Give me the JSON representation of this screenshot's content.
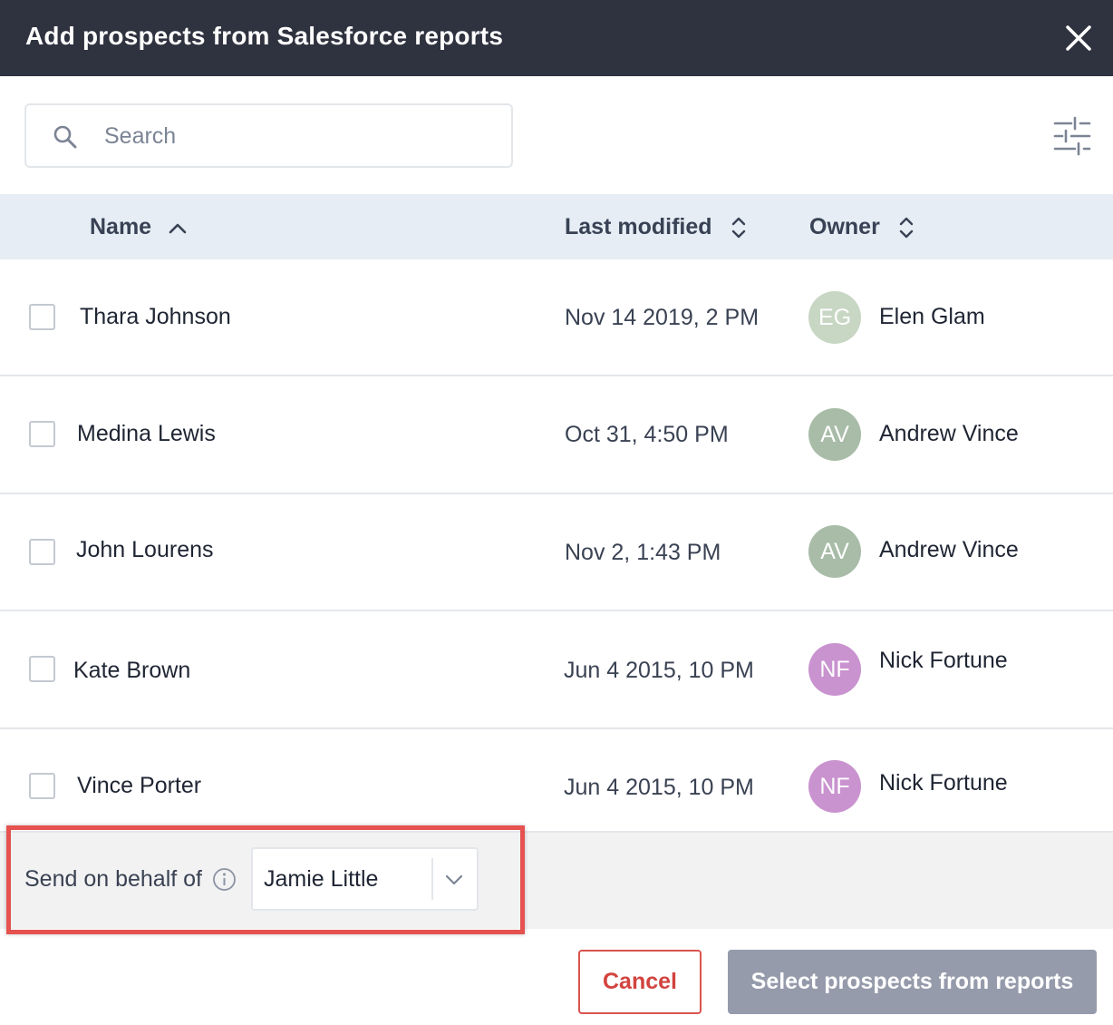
{
  "header": {
    "title": "Add prospects from Salesforce reports"
  },
  "search": {
    "placeholder": "Search",
    "value": ""
  },
  "table": {
    "columns": {
      "name": "Name",
      "last_modified": "Last modified",
      "owner": "Owner"
    },
    "rows": [
      {
        "name": "Thara Johnson",
        "last_modified": "Nov 14 2019, 2 PM",
        "owner_initials": "EG",
        "owner": "Elen Glam",
        "owner_color": "#c8d6c4",
        "checked": false
      },
      {
        "name": "Medina Lewis",
        "last_modified": "Oct 31, 4:50 PM",
        "owner_initials": "AV",
        "owner": "Andrew Vince",
        "owner_color": "#a8bca8",
        "checked": false
      },
      {
        "name": "John Lourens",
        "last_modified": "Nov 2, 1:43 PM",
        "owner_initials": "AV",
        "owner": "Andrew Vince",
        "owner_color": "#a8bca8",
        "checked": false
      },
      {
        "name": "Kate Brown",
        "last_modified": "Jun 4 2015, 10 PM",
        "owner_initials": "NF",
        "owner": "Nick Fortune",
        "owner_color": "#c993cf",
        "checked": false
      },
      {
        "name": "Vince Porter",
        "last_modified": "Jun 4 2015, 10 PM",
        "owner_initials": "NF",
        "owner": "Nick Fortune",
        "owner_color": "#c993cf",
        "checked": false
      }
    ]
  },
  "footer": {
    "behalf_label": "Send on behalf of",
    "behalf_value": "Jamie Little",
    "cancel_label": "Cancel",
    "primary_label": "Select prospects from reports"
  },
  "icons": {
    "close": "close-icon",
    "search": "search-icon",
    "filter": "sliders-icon",
    "sort_asc": "chevron-up-icon",
    "sort": "sort-icon",
    "info": "info-icon",
    "dropdown": "chevron-down-icon"
  },
  "colors": {
    "header_bg": "#2f323f",
    "table_head_bg": "#e6edf5",
    "highlight": "#e5524f",
    "cancel": "#d2443f",
    "primary_disabled": "#959bab"
  }
}
